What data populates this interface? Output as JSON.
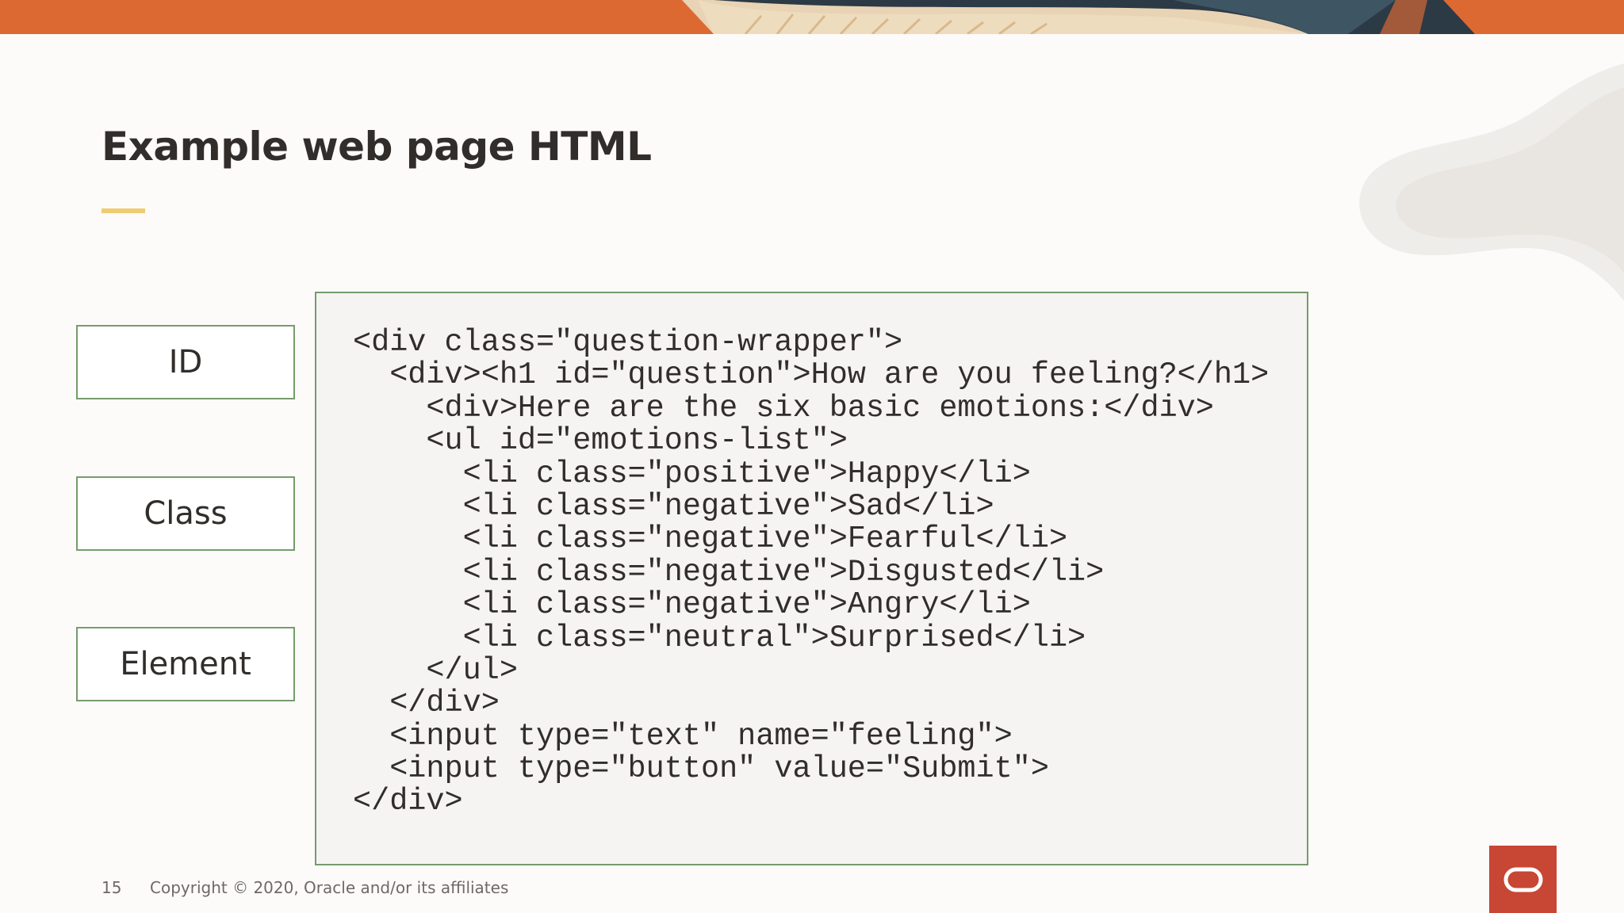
{
  "slide": {
    "title": "Example web page HTML",
    "labels": {
      "id": "ID",
      "class": "Class",
      "element": "Element"
    },
    "code_lines": [
      "<div class=\"question-wrapper\">",
      "  <div><h1 id=\"question\">How are you feeling?</h1>",
      "    <div>Here are the six basic emotions:</div>",
      "    <ul id=\"emotions-list\">",
      "      <li class=\"positive\">Happy</li>",
      "      <li class=\"negative\">Sad</li>",
      "      <li class=\"negative\">Fearful</li>",
      "      <li class=\"negative\">Disgusted</li>",
      "      <li class=\"negative\">Angry</li>",
      "      <li class=\"neutral\">Surprised</li>",
      "    </ul>",
      "  </div>",
      "  <input type=\"text\" name=\"feeling\">",
      "  <input type=\"button\" value=\"Submit\">",
      "</div>"
    ]
  },
  "footer": {
    "page_number": "15",
    "copyright": "Copyright © 2020, Oracle and/or its affiliates"
  },
  "colors": {
    "box_border": "#759c6c",
    "accent_bar": "#f0cc71",
    "logo_bg": "#c74634",
    "text": "#312d2a"
  },
  "icons": {
    "logo": "oracle-logo-icon"
  }
}
